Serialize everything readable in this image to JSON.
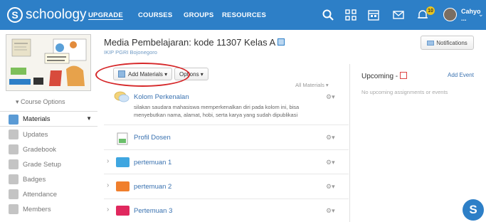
{
  "brand": {
    "name": "schoology"
  },
  "nav": {
    "upgrade": "UPGRADE",
    "courses": "COURSES",
    "groups": "GROUPS",
    "resources": "RESOURCES"
  },
  "user": {
    "name": "Cahyo ...",
    "notification_count": "10"
  },
  "course": {
    "title": "Media Pembelajaran: kode 11307 Kelas A",
    "school": "IKIP PGRI Bojonegoro"
  },
  "sidebar": {
    "course_options": "Course Options",
    "items": [
      {
        "label": "Materials",
        "icon": "materials-icon",
        "color": "#5b9bd5"
      },
      {
        "label": "Updates",
        "icon": "updates-icon",
        "color": "#b0b0b0"
      },
      {
        "label": "Gradebook",
        "icon": "gradebook-icon",
        "color": "#b0b0b0"
      },
      {
        "label": "Grade Setup",
        "icon": "grade-setup-icon",
        "color": "#b0b0b0"
      },
      {
        "label": "Badges",
        "icon": "badge-icon",
        "color": "#b0b0b0"
      },
      {
        "label": "Attendance",
        "icon": "attendance-icon",
        "color": "#b0b0b0"
      },
      {
        "label": "Members",
        "icon": "members-icon",
        "color": "#b0b0b0"
      }
    ]
  },
  "toolbar": {
    "add_materials": "Add Materials",
    "options": "Options",
    "all_materials": "All Materials",
    "notifications": "Notifications"
  },
  "materials": [
    {
      "title": "Kolom Perkenalan",
      "type": "discussion",
      "desc": "silakan saudara mahasiswa memperkenalkan diri pada kolom ini, bisa menyebutkan nama, alamat, hobi, serta karya yang sudah dipublikasi"
    },
    {
      "title": "Profil Dosen",
      "type": "page"
    },
    {
      "title": "pertemuan 1",
      "type": "folder",
      "color": "#3fa6e0"
    },
    {
      "title": "pertemuan 2",
      "type": "folder",
      "color": "#f07f2d"
    },
    {
      "title": "Pertemuan 3",
      "type": "folder",
      "color": "#e0285e"
    }
  ],
  "upcoming": {
    "title": "Upcoming -",
    "add_event": "Add Event",
    "empty": "No upcoming assignments or events"
  },
  "colors": {
    "brand": "#2d7fc7",
    "highlight": "#d6282a"
  }
}
